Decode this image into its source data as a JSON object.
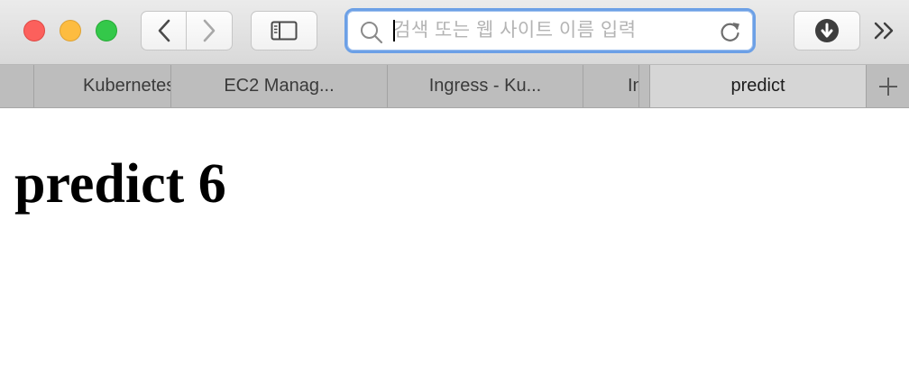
{
  "toolbar": {
    "address": {
      "placeholder": "검색 또는 웹 사이트 이름 입력",
      "value": ""
    },
    "icons": {
      "back": "chevron-left-icon",
      "forward": "chevron-right-icon",
      "sidebar": "sidebar-icon",
      "search": "search-icon",
      "reload": "reload-icon",
      "download": "download-icon",
      "overflow": "double-chevron-right-icon"
    }
  },
  "tabs": [
    {
      "label": "Kubernetes"
    },
    {
      "label": "EC2 Manag..."
    },
    {
      "label": "Ingress - Ku..."
    },
    {
      "label": "In"
    },
    {
      "label": ""
    },
    {
      "label": "predict",
      "active": true
    }
  ],
  "page": {
    "heading": "predict 6"
  },
  "colors": {
    "address_focus": "#6ca0e6",
    "close": "#fc605c",
    "minimize": "#fdbc40",
    "maximize": "#34c84a"
  }
}
